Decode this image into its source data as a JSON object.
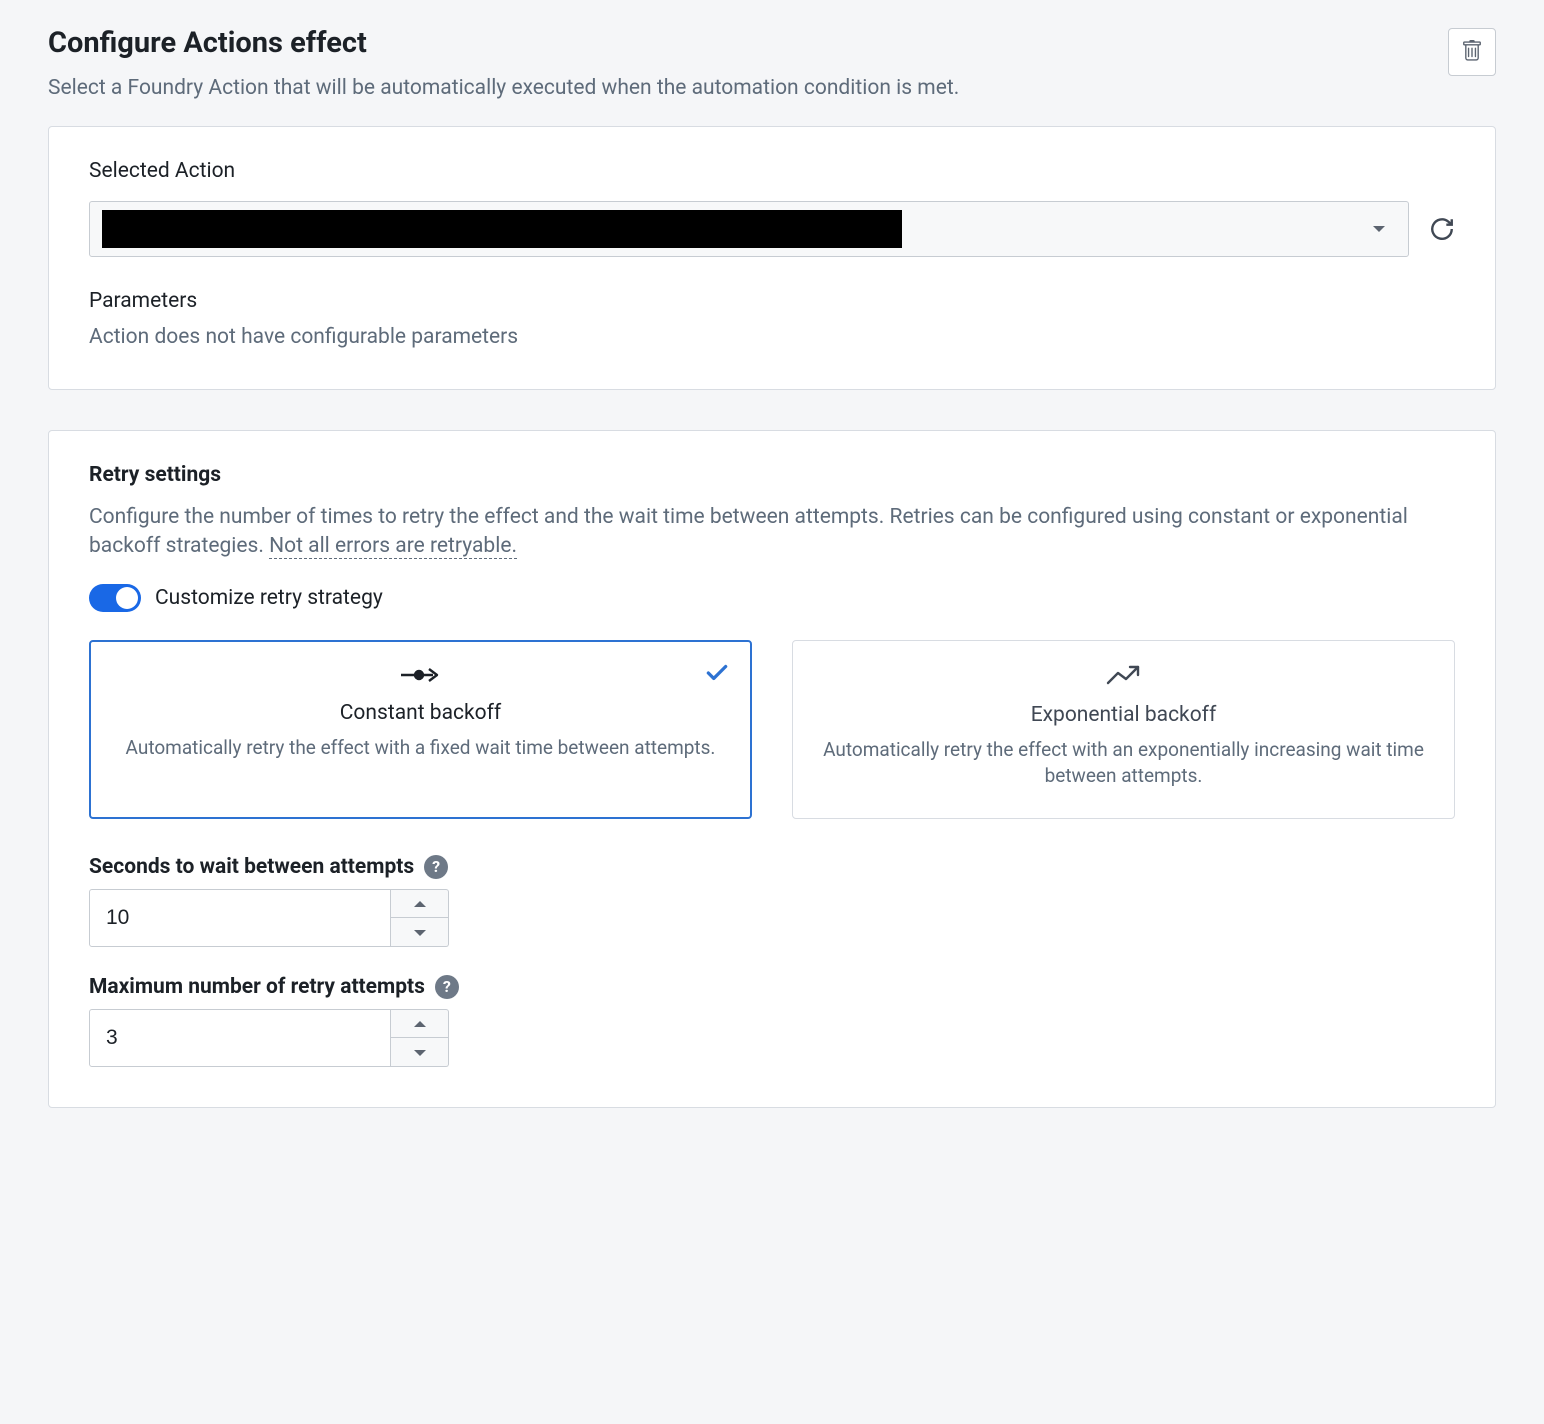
{
  "header": {
    "title": "Configure Actions effect",
    "subtitle": "Select a Foundry Action that will be automatically executed when the automation condition is met."
  },
  "action": {
    "section_label": "Selected Action",
    "params_label": "Parameters",
    "params_empty": "Action does not have configurable parameters"
  },
  "retry": {
    "title": "Retry settings",
    "description_prefix": "Configure the number of times to retry the effect and the wait time between attempts. Retries can be configured using constant or exponential backoff strategies. ",
    "description_link": "Not all errors are retryable.",
    "toggle_label": "Customize retry strategy",
    "toggle_on": true,
    "strategies": {
      "constant": {
        "title": "Constant backoff",
        "desc": "Automatically retry the effect with a fixed wait time between attempts."
      },
      "exponential": {
        "title": "Exponential backoff",
        "desc": "Automatically retry the effect with an exponentially increasing wait time between attempts."
      }
    },
    "fields": {
      "wait_label": "Seconds to wait between attempts",
      "wait_value": "10",
      "max_label": "Maximum number of retry attempts",
      "max_value": "3"
    }
  }
}
